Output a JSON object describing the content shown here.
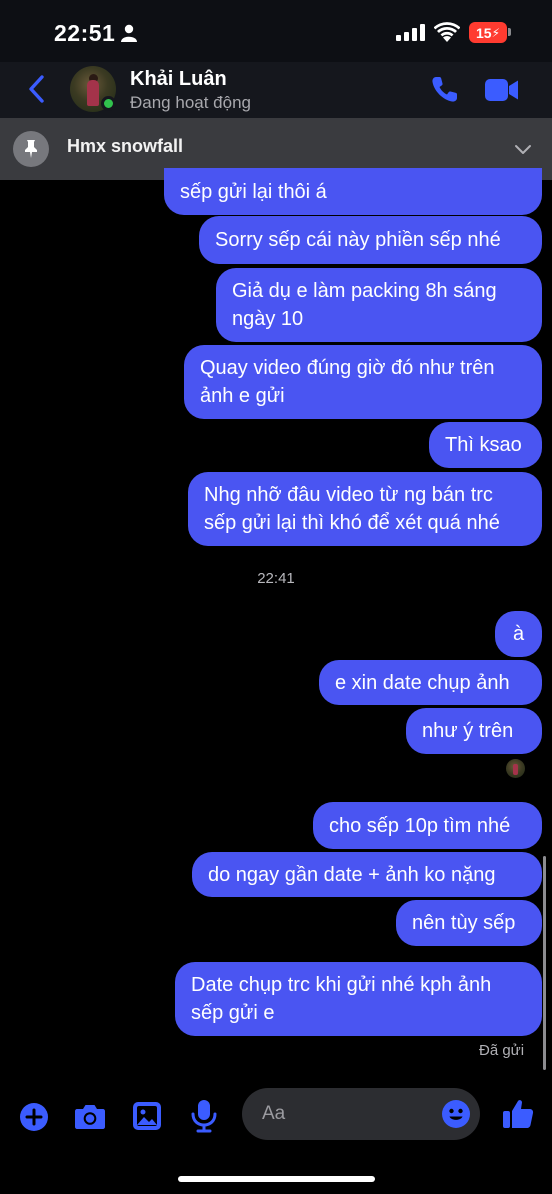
{
  "status_bar": {
    "time": "22:51",
    "battery": "15"
  },
  "header": {
    "contact_name": "Khải Luân",
    "presence": "Đang hoạt động"
  },
  "pinned": {
    "title": "Hmx snowfall"
  },
  "messages": [
    {
      "text": "sếp gửi lại thôi á"
    },
    {
      "text": "Sorry sếp cái này phiền sếp nhé"
    },
    {
      "line1": "Giả dụ e làm packing 8h sáng",
      "line2": "ngày 10"
    },
    {
      "line1": "Quay video đúng giờ đó như trên",
      "line2": "ảnh e gửi"
    },
    {
      "text": "Thì ksao"
    },
    {
      "line1": "Nhg nhỡ đâu video từ ng bán trc",
      "line2": "sếp gửi lại thì khó để xét quá nhé"
    },
    {
      "text": "à"
    },
    {
      "text": "e xin date chụp ảnh"
    },
    {
      "text": "như ý trên"
    },
    {
      "text": "cho sếp 10p tìm nhé"
    },
    {
      "text": "do ngay gần date + ảnh ko nặng"
    },
    {
      "text": "nên tùy sếp"
    },
    {
      "line1": "Date chụp trc khi gửi nhé kph ảnh",
      "line2": "sếp gửi e"
    }
  ],
  "timestamp": "22:41",
  "delivery_status": "Đã gửi",
  "composer": {
    "placeholder": "Aa"
  },
  "colors": {
    "bubble": "#4a55f2",
    "accent": "#3b5cff",
    "background": "#000000",
    "online": "#31c24d"
  },
  "icons": [
    "person-icon",
    "signal-icon",
    "wifi-icon",
    "battery-icon",
    "back-icon",
    "phone-icon",
    "video-call-icon",
    "pin-icon",
    "chevron-down-icon",
    "plus-icon",
    "camera-icon",
    "image-icon",
    "microphone-icon",
    "emoji-icon",
    "thumbs-up-icon"
  ]
}
